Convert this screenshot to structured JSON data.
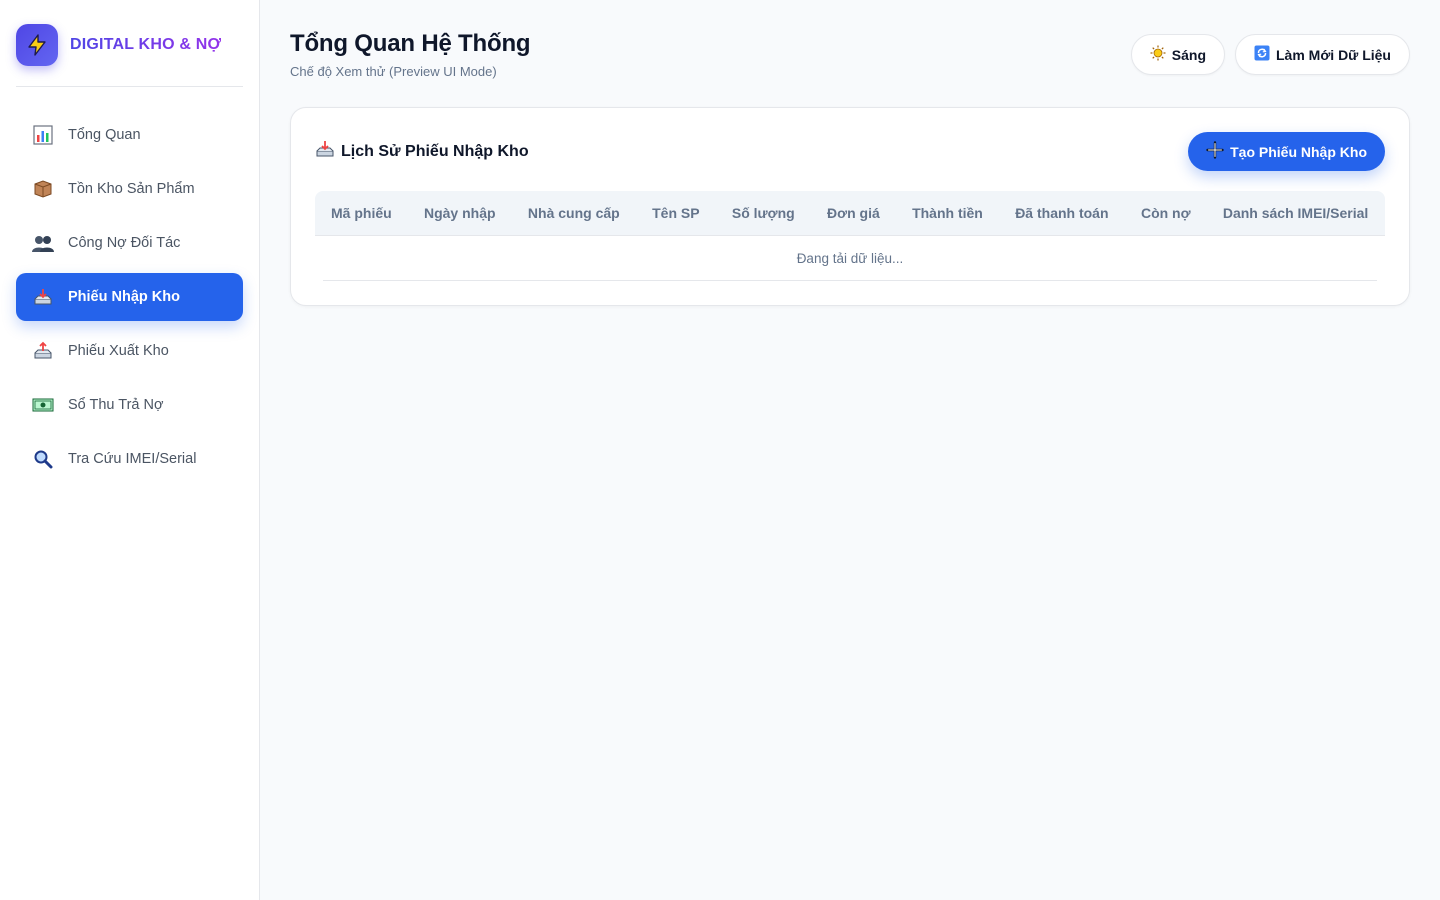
{
  "brand": {
    "name": "DIGITAL KHO & NỢ",
    "logo_icon": "lightning-icon"
  },
  "sidebar": {
    "items": [
      {
        "label": "Tổng Quan",
        "icon": "bar-chart-icon",
        "active": false
      },
      {
        "label": "Tồn Kho Sản Phẩm",
        "icon": "package-icon",
        "active": false
      },
      {
        "label": "Công Nợ Đối Tác",
        "icon": "users-icon",
        "active": false
      },
      {
        "label": "Phiếu Nhập Kho",
        "icon": "inbox-tray-icon",
        "active": true
      },
      {
        "label": "Phiếu Xuất Kho",
        "icon": "outbox-tray-icon",
        "active": false
      },
      {
        "label": "Sổ Thu Trả Nợ",
        "icon": "money-icon",
        "active": false
      },
      {
        "label": "Tra Cứu IMEI/Serial",
        "icon": "magnifier-icon",
        "active": false
      }
    ]
  },
  "header": {
    "title": "Tổng Quan Hệ Thống",
    "subtitle": "Chế độ Xem thử (Preview UI Mode)",
    "theme_button": "Sáng",
    "refresh_button": "Làm Mới Dữ Liệu"
  },
  "card": {
    "title": "Lịch Sử Phiếu Nhập Kho",
    "create_button": "Tạo Phiếu Nhập Kho",
    "columns": [
      "Mã phiếu",
      "Ngày nhập",
      "Nhà cung cấp",
      "Tên SP",
      "Số lượng",
      "Đơn giá",
      "Thành tiền",
      "Đã thanh toán",
      "Còn nợ",
      "Danh sách IMEI/Serial"
    ],
    "empty_text": "Đang tải dữ liệu..."
  },
  "colors": {
    "accent": "#2563eb",
    "brand": "#4f46e5",
    "background": "#f8fafc"
  }
}
